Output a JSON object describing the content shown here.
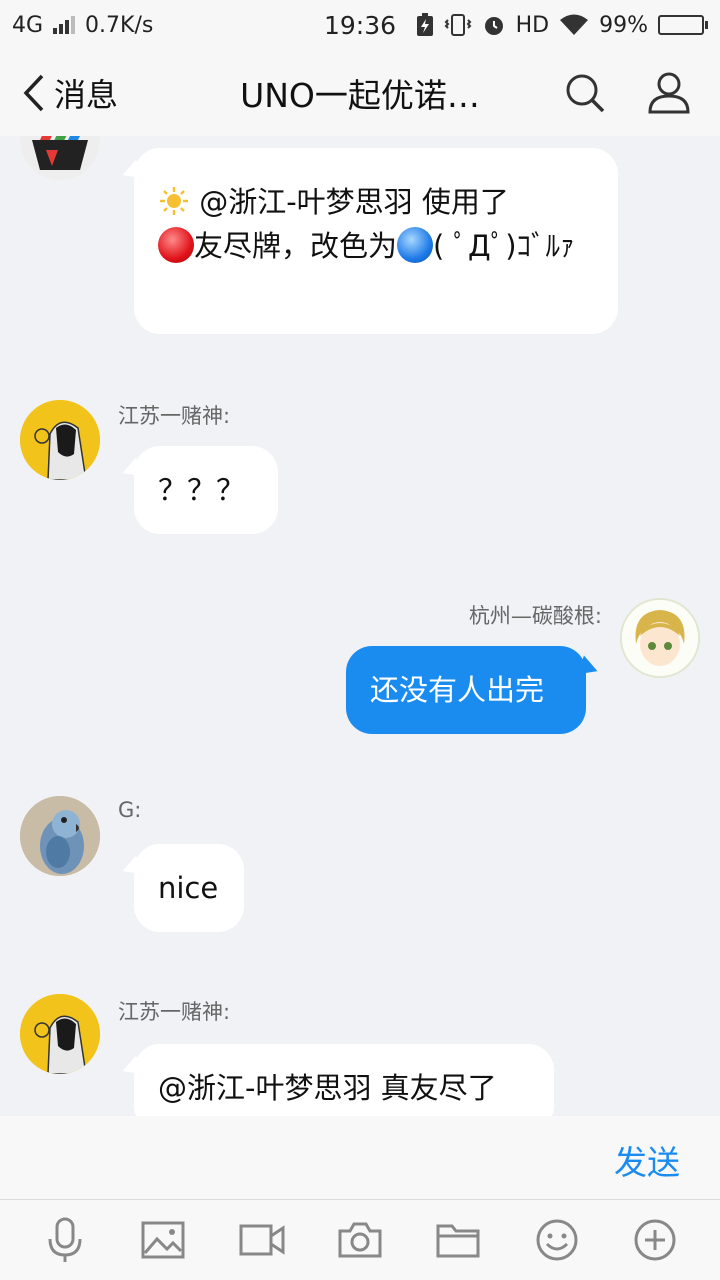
{
  "status_bar": {
    "network": "4G",
    "speed": "0.7K/s",
    "time": "19:36",
    "hd": "HD",
    "battery": "99%",
    "battery_level": 0.99
  },
  "header": {
    "back_label": "消息",
    "title": "UNO一起优诺…"
  },
  "messages": [
    {
      "side": "in",
      "parts": [
        "@浙江-叶梦思羽  使用了",
        "友尽牌，改色为",
        "( ﾟДﾟ)ｺﾞﾙｧ"
      ]
    },
    {
      "side": "in",
      "sender": "江苏一赌神:",
      "text": "？？？"
    },
    {
      "side": "out",
      "sender": "杭州—碳酸根:",
      "text": "还没有人出完"
    },
    {
      "side": "in",
      "sender": "G:",
      "text": "nice"
    },
    {
      "side": "in",
      "sender": "江苏一赌神:",
      "text": "@浙江-叶梦思羽 真友尽了"
    }
  ],
  "input": {
    "value": "",
    "send_label": "发送"
  },
  "toolbar": [
    "microphone-icon",
    "image-icon",
    "video-icon",
    "camera-icon",
    "folder-icon",
    "emoji-icon",
    "plus-icon"
  ],
  "colors": {
    "accent": "#1a8cf0",
    "background": "#f1f2f6",
    "bubble_in": "#ffffff"
  }
}
